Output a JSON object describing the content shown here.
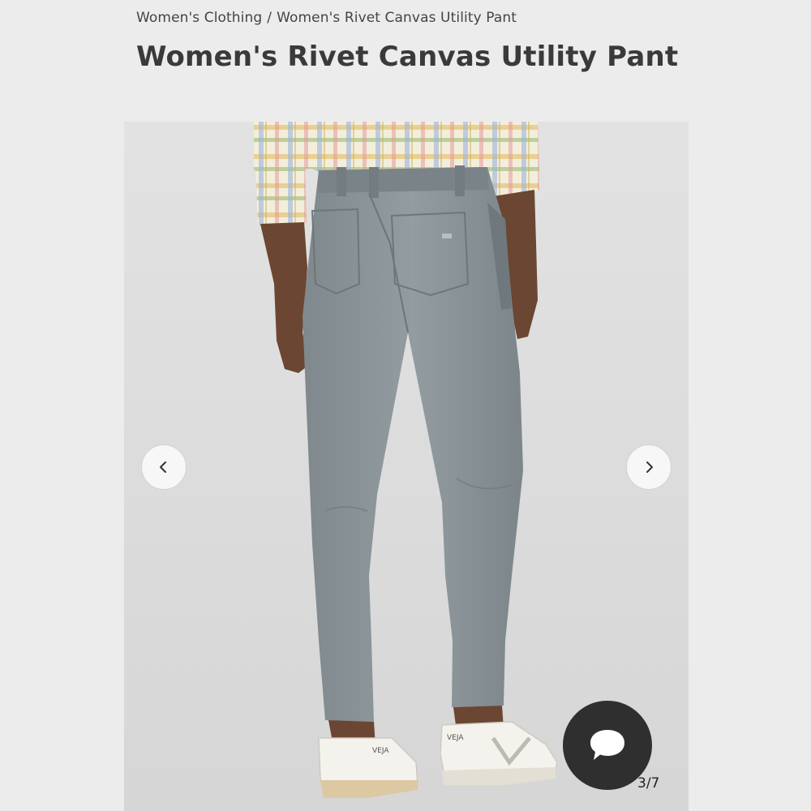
{
  "breadcrumb": {
    "category": "Women's Clothing",
    "separator": "/",
    "current": "Women's Rivet Canvas Utility Pant"
  },
  "product": {
    "title": "Women's Rivet Canvas Utility Pant"
  },
  "gallery": {
    "current_image": 3,
    "total_images": 7,
    "counter_text": "3/7",
    "shoe_text": "VEJA"
  },
  "icons": {
    "prev": "chevron-left-icon",
    "next": "chevron-right-icon",
    "chat": "chat-bubble-icon"
  },
  "colors": {
    "pant": "#8a9398",
    "background": "#ececec",
    "chat_button": "#2f2f2f"
  }
}
